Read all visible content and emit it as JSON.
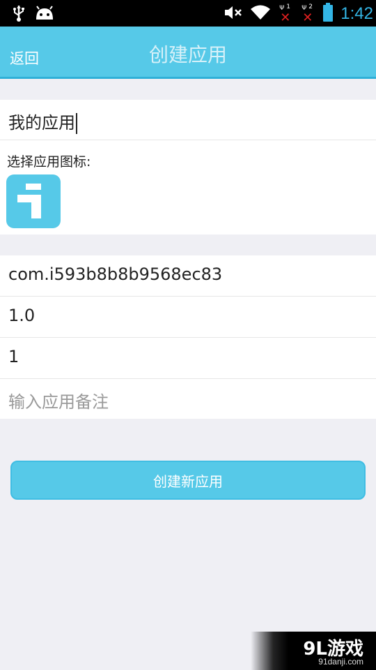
{
  "status_bar": {
    "time": "1:42",
    "sim1_label": "1",
    "sim2_label": "2",
    "icons": [
      "usb-icon",
      "android-icon",
      "mute-icon",
      "wifi-icon",
      "no-signal-icon",
      "battery-icon"
    ]
  },
  "header": {
    "back_label": "返回",
    "title": "创建应用"
  },
  "form": {
    "app_name": "我的应用",
    "icon_label": "选择应用图标:",
    "package_name": "com.i593b8b8b9568ec83",
    "version_name": "1.0",
    "version_code": "1",
    "remark_placeholder": "输入应用备注"
  },
  "create_button_label": "创建新应用",
  "watermark": {
    "logo_text": "9L游戏",
    "url": "91danji.com"
  },
  "colors": {
    "accent": "#56c9e8",
    "status_time": "#33b5e5",
    "background": "#efeff4"
  }
}
